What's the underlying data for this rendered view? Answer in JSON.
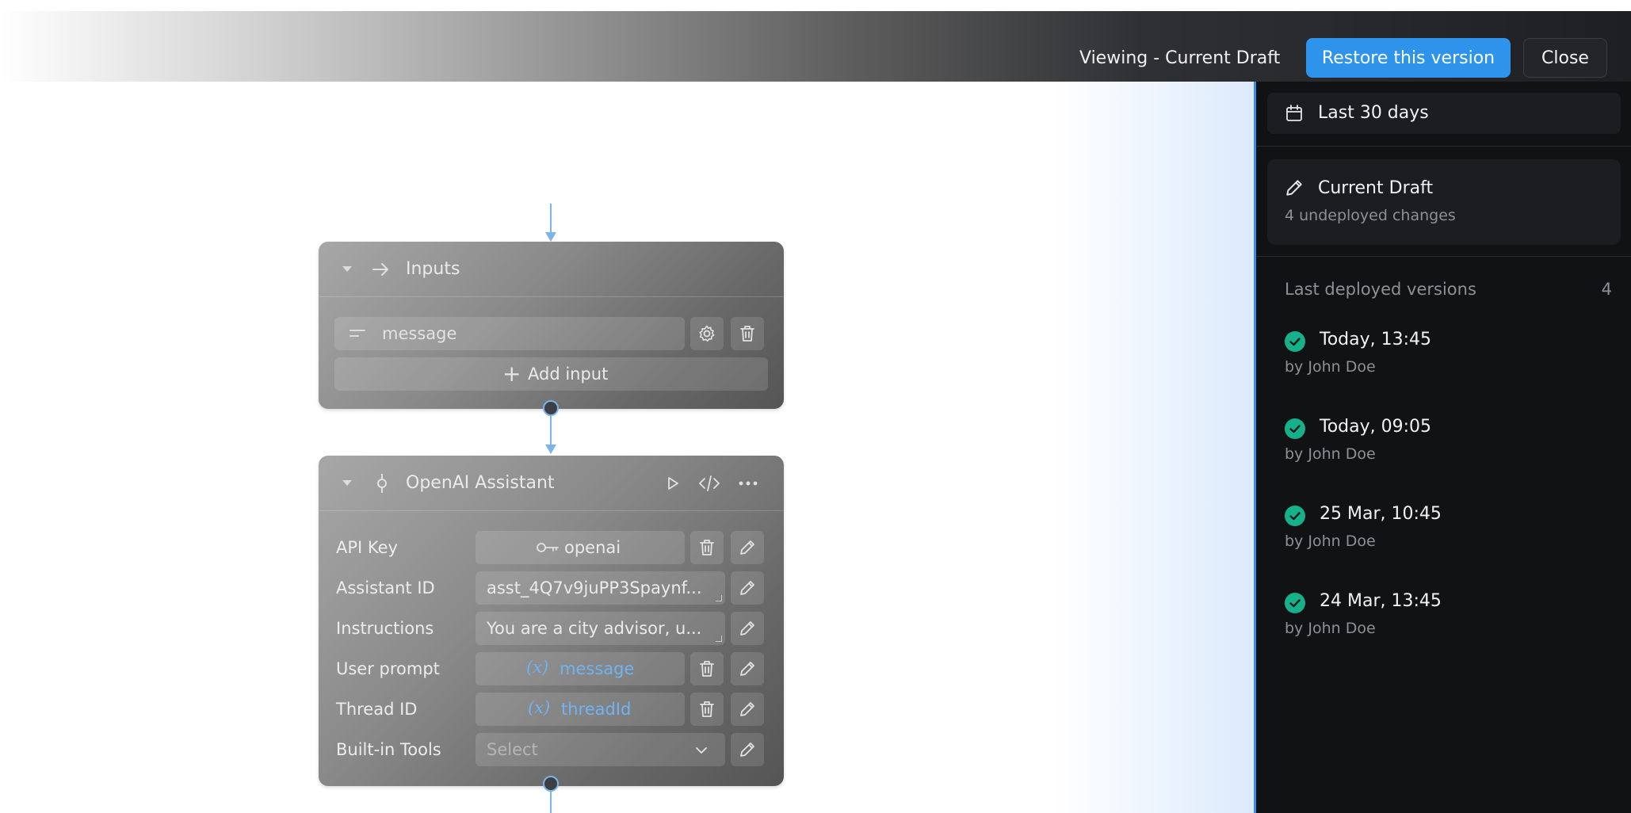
{
  "header": {
    "viewing_label": "Viewing - Current Draft",
    "restore_label": "Restore this version",
    "close_label": "Close"
  },
  "canvas": {
    "inputs_node": {
      "title": "Inputs",
      "inputs": [
        {
          "name": "message"
        }
      ],
      "add_input_label": "Add input"
    },
    "assistant_node": {
      "title": "OpenAI Assistant",
      "rows": {
        "api_key": {
          "label": "API Key",
          "value": "openai"
        },
        "assistant_id": {
          "label": "Assistant ID",
          "value": "asst_4Q7v9juPP3Spaynf..."
        },
        "instructions": {
          "label": "Instructions",
          "value": "You are a city advisor, u..."
        },
        "user_prompt": {
          "label": "User prompt",
          "value": "message"
        },
        "thread_id": {
          "label": "Thread ID",
          "value": "threadId"
        },
        "built_in_tools": {
          "label": "Built-in Tools",
          "placeholder": "Select"
        }
      }
    }
  },
  "panel": {
    "date_filter": "Last 30 days",
    "draft": {
      "title": "Current Draft",
      "subtitle": "4 undeployed changes"
    },
    "deployed": {
      "title": "Last deployed versions",
      "count": "4",
      "versions": [
        {
          "time": "Today, 13:45",
          "author": "by John Doe"
        },
        {
          "time": "Today, 09:05",
          "author": "by John Doe"
        },
        {
          "time": "25 Mar, 10:45",
          "author": "by John Doe"
        },
        {
          "time": "24 Mar, 13:45",
          "author": "by John Doe"
        }
      ]
    }
  },
  "colors": {
    "accent": "#2e93ea",
    "success": "#16b08a",
    "variable": "#6fb3f2",
    "panel_bg": "#111214"
  },
  "icons": {
    "date_filter": "calendar-icon",
    "draft": "pencil-icon",
    "version_status": "check-circle-icon",
    "inputs_node": "arrow-in-icon",
    "assistant_node": "commit-node-icon"
  }
}
